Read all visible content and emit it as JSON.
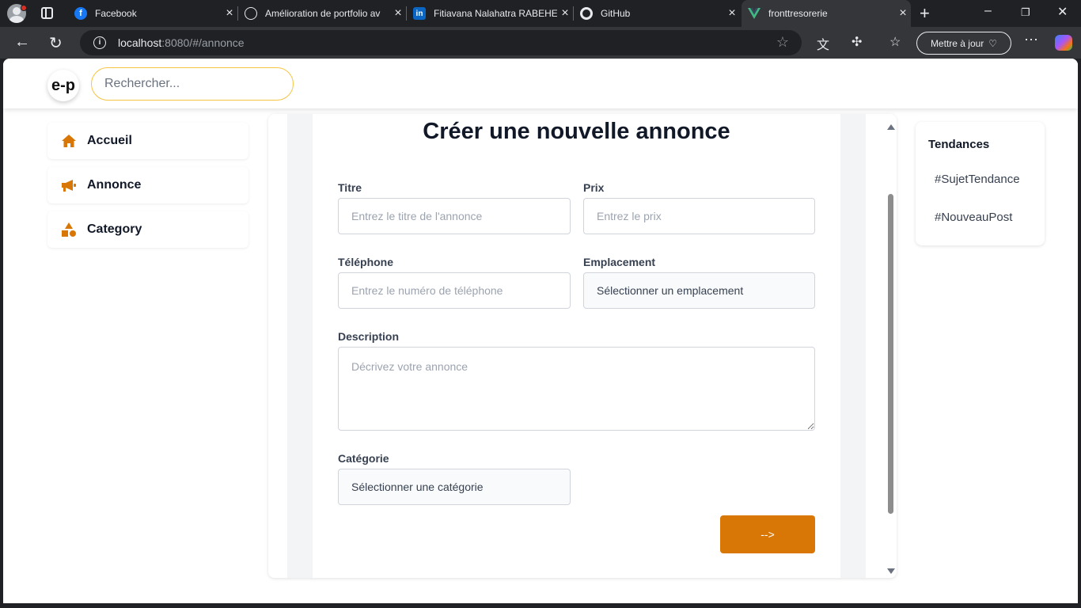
{
  "browser": {
    "tabs": [
      {
        "title": "Facebook",
        "icon": "facebook-icon"
      },
      {
        "title": "Amélioration de portfolio av",
        "icon": "openai-icon"
      },
      {
        "title": "Fitiavana Nalahatra RABEHE…",
        "icon": "linkedin-icon"
      },
      {
        "title": "GitHub",
        "icon": "github-icon"
      },
      {
        "title": "fronttresorerie",
        "icon": "vue-icon"
      }
    ],
    "url_host": "localhost",
    "url_rest": ":8080/#/annonce",
    "update_label": "Mettre à jour"
  },
  "header": {
    "logo": "e-p",
    "search_placeholder": "Rechercher..."
  },
  "sidebar": {
    "items": [
      {
        "label": "Accueil",
        "icon": "home-icon"
      },
      {
        "label": "Annonce",
        "icon": "megaphone-icon"
      },
      {
        "label": "Category",
        "icon": "shapes-icon"
      }
    ]
  },
  "form": {
    "title": "Créer une nouvelle annonce",
    "titre_label": "Titre",
    "titre_placeholder": "Entrez le titre de l'annonce",
    "prix_label": "Prix",
    "prix_placeholder": "Entrez le prix",
    "telephone_label": "Téléphone",
    "telephone_placeholder": "Entrez le numéro de téléphone",
    "emplacement_label": "Emplacement",
    "emplacement_value": "Sélectionner un emplacement",
    "description_label": "Description",
    "description_placeholder": "Décrivez votre annonce",
    "categorie_label": "Catégorie",
    "categorie_value": "Sélectionner une catégorie",
    "submit_label": "-->"
  },
  "trends": {
    "title": "Tendances",
    "items": [
      "#SujetTendance",
      "#NouveauPost"
    ]
  },
  "colors": {
    "accent": "#d97706",
    "search_border": "#f6c544"
  }
}
